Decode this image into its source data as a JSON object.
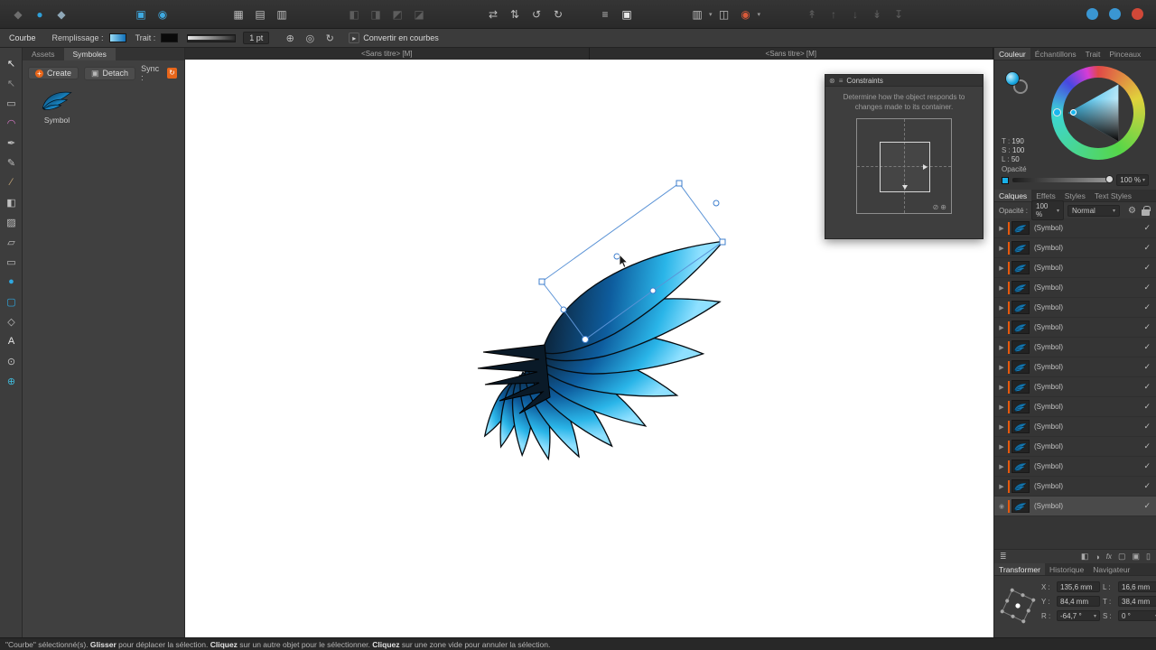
{
  "top_toolbar": {
    "groups": [
      {
        "name": "app",
        "mr": 64,
        "items": [
          {
            "name": "app-menu-icon",
            "glyph": "◆",
            "color": "#6e6e6e"
          },
          {
            "name": "persona-draw-icon",
            "glyph": "●",
            "color": "#2f9fd8"
          },
          {
            "name": "persona-export-icon",
            "glyph": "◆",
            "color": "#8fa8b8"
          }
        ]
      },
      {
        "name": "personas",
        "mr": 60,
        "items": [
          {
            "name": "persona-pixel-icon",
            "glyph": "▣",
            "color": "#3fa9e0"
          },
          {
            "name": "persona-vector-icon",
            "glyph": "◉",
            "color": "#3fa9e0"
          }
        ]
      },
      {
        "name": "snapping",
        "mr": 56,
        "items": [
          {
            "name": "grid-icon",
            "glyph": "▦"
          },
          {
            "name": "guides-icon",
            "glyph": "▤"
          },
          {
            "name": "columns-icon",
            "glyph": "▥"
          }
        ]
      },
      {
        "name": "boolean",
        "mr": 58,
        "items": [
          {
            "name": "boolean-add-icon",
            "glyph": "◧",
            "disabled": true
          },
          {
            "name": "boolean-subtract-icon",
            "glyph": "◨",
            "disabled": true
          },
          {
            "name": "boolean-intersect-icon",
            "glyph": "◩",
            "disabled": true
          },
          {
            "name": "boolean-divide-icon",
            "glyph": "◪",
            "disabled": true
          }
        ]
      },
      {
        "name": "transform",
        "mr": 28,
        "items": [
          {
            "name": "flip-horizontal-icon",
            "glyph": "⇄"
          },
          {
            "name": "flip-vertical-icon",
            "glyph": "⇅"
          },
          {
            "name": "rotate-ccw-icon",
            "glyph": "↺"
          },
          {
            "name": "rotate-cw-icon",
            "glyph": "↻"
          }
        ]
      },
      {
        "name": "order",
        "mr": 54,
        "items": [
          {
            "name": "insertion-order-icon",
            "glyph": "≡"
          },
          {
            "name": "insert-inside-icon",
            "glyph": "▣",
            "color": "#e8e8e8"
          }
        ]
      },
      {
        "name": "view-options",
        "mr": 44,
        "items": [
          {
            "name": "text-flow-icon",
            "glyph": "▥",
            "caret": true
          },
          {
            "name": "divider-icon",
            "glyph": "◫"
          },
          {
            "name": "snapping-manager-icon",
            "glyph": "◉",
            "color": "#d85a3a",
            "caret": true
          }
        ]
      },
      {
        "name": "arrange",
        "mr": 0,
        "items": [
          {
            "name": "move-to-front-icon",
            "glyph": "↟",
            "disabled": true
          },
          {
            "name": "move-forward-icon",
            "glyph": "↑",
            "disabled": true
          },
          {
            "name": "move-backward-icon",
            "glyph": "↓",
            "disabled": true
          },
          {
            "name": "move-to-back-icon",
            "glyph": "↡",
            "disabled": true
          },
          {
            "name": "move-inside-icon",
            "glyph": "↧",
            "disabled": true
          }
        ]
      },
      {
        "name": "help",
        "right": true,
        "items": [
          {
            "name": "search-icon",
            "bg": "#3a96d2"
          },
          {
            "name": "help-icon",
            "bg": "#3a96d2"
          },
          {
            "name": "record-icon",
            "bg": "#d04838"
          }
        ]
      }
    ]
  },
  "context_toolbar": {
    "object_type": "Courbe",
    "fill_label": "Remplissage :",
    "stroke_label": "Trait :",
    "stroke_width": "1 pt",
    "icon_1": "⊕",
    "icon_2": "◎",
    "icon_3": "↻",
    "convert_icon": "▸",
    "convert_button": "Convertir en courbes"
  },
  "left_toolbar": {
    "tools": [
      {
        "name": "move-tool",
        "glyph": "↖",
        "color": "#ececec"
      },
      {
        "name": "node-tool",
        "glyph": "↖",
        "color": "#8a8a8a"
      },
      {
        "name": "artboard-tool",
        "glyph": "▭"
      },
      {
        "name": "corner-tool",
        "glyph": "◠",
        "color": "#d878c8"
      },
      {
        "name": "pen-tool",
        "glyph": "✒"
      },
      {
        "name": "pencil-tool",
        "glyph": "✎"
      },
      {
        "name": "brush-tool",
        "glyph": "∕",
        "color": "#c8a878"
      },
      {
        "name": "fill-tool",
        "glyph": "◧"
      },
      {
        "name": "transparency-tool",
        "glyph": "▨"
      },
      {
        "name": "vector-crop-tool",
        "glyph": "▱"
      },
      {
        "name": "rectangle-tool",
        "glyph": "▭"
      },
      {
        "name": "ellipse-tool",
        "glyph": "●",
        "color": "#2fa8e0"
      },
      {
        "name": "rounded-rectangle-tool",
        "glyph": "▢",
        "color": "#2fa8e0"
      },
      {
        "name": "star-tool",
        "glyph": "◇"
      },
      {
        "name": "text-tool",
        "glyph": "A",
        "color": "#e6e6e6"
      },
      {
        "name": "zoom-tool",
        "glyph": "⊙"
      },
      {
        "name": "color-picker-tool",
        "glyph": "⊕",
        "color": "#40b8d8"
      }
    ]
  },
  "symbols_panel": {
    "tab_assets": "Assets",
    "tab_symbols": "Symboles",
    "create_button": "Create",
    "detach_button": "Detach",
    "sync_label": "Sync :",
    "symbol_item_label": "Symbol"
  },
  "document_tabs": [
    "<Sans titre> [M]",
    "<Sans titre> [M]"
  ],
  "constraints_panel": {
    "title": "Constraints",
    "description": "Determine how the object responds to changes made to its container."
  },
  "color_panel": {
    "tabs": [
      "Couleur",
      "Échantillons",
      "Trait",
      "Pinceaux"
    ],
    "active_tab": "Couleur",
    "hsl": [
      {
        "label": "T :",
        "value": "190"
      },
      {
        "label": "S :",
        "value": "100"
      },
      {
        "label": "L :",
        "value": "50"
      }
    ],
    "opacity_label": "Opacité",
    "opacity_value": "100 %",
    "accent_color": "#19b0e8"
  },
  "layers_panel": {
    "tabs": [
      "Calques",
      "Effets",
      "Styles",
      "Text Styles"
    ],
    "active_tab": "Calques",
    "opacity_label": "Opacité :",
    "opacity_value": "100 %",
    "blend_mode": "Normal",
    "check_glyph": "✓",
    "indicator_color": "#e8590c",
    "rows": [
      {
        "label": "(Symbol)"
      },
      {
        "label": "(Symbol)"
      },
      {
        "label": "(Symbol)"
      },
      {
        "label": "(Symbol)"
      },
      {
        "label": "(Symbol)"
      },
      {
        "label": "(Symbol)"
      },
      {
        "label": "(Symbol)"
      },
      {
        "label": "(Symbol)"
      },
      {
        "label": "(Symbol)"
      },
      {
        "label": "(Symbol)"
      },
      {
        "label": "(Symbol)"
      },
      {
        "label": "(Symbol)"
      },
      {
        "label": "(Symbol)"
      },
      {
        "label": "(Symbol)"
      },
      {
        "label": "(Symbol)",
        "selected": true
      }
    ],
    "footer_icons": [
      {
        "name": "layer-stack-icon",
        "glyph": "≣"
      },
      {
        "name": "mask-icon",
        "glyph": "◧",
        "right": true
      },
      {
        "name": "adjustment-icon",
        "glyph": "◑"
      },
      {
        "name": "fx-icon",
        "glyph": "fx",
        "fx": true
      },
      {
        "name": "new-layer-icon",
        "glyph": "▢"
      },
      {
        "name": "new-group-icon",
        "glyph": "▣"
      },
      {
        "name": "delete-icon",
        "glyph": "▯"
      }
    ]
  },
  "transform_panel": {
    "tabs": [
      "Transformer",
      "Historique",
      "Navigateur"
    ],
    "active_tab": "Transformer",
    "fields": [
      {
        "label": "X :",
        "value": "135,6 mm"
      },
      {
        "label": "L :",
        "value": "16,6 mm"
      },
      {
        "label": "Y :",
        "value": "84,4 mm"
      },
      {
        "label": "T :",
        "value": "38,4 mm"
      },
      {
        "label": "R :",
        "value": "-64,7 °"
      },
      {
        "label": "S :",
        "value": "0 °"
      }
    ]
  },
  "status_bar": {
    "part1": "\"Courbe\" sélectionné(s). ",
    "bold1": "Glisser",
    "part2": " pour déplacer la sélection. ",
    "bold2": "Cliquez",
    "part3": " sur un autre objet pour le sélectionner. ",
    "bold3": "Cliquez",
    "part4": " sur une zone vide pour annuler la sélection."
  }
}
